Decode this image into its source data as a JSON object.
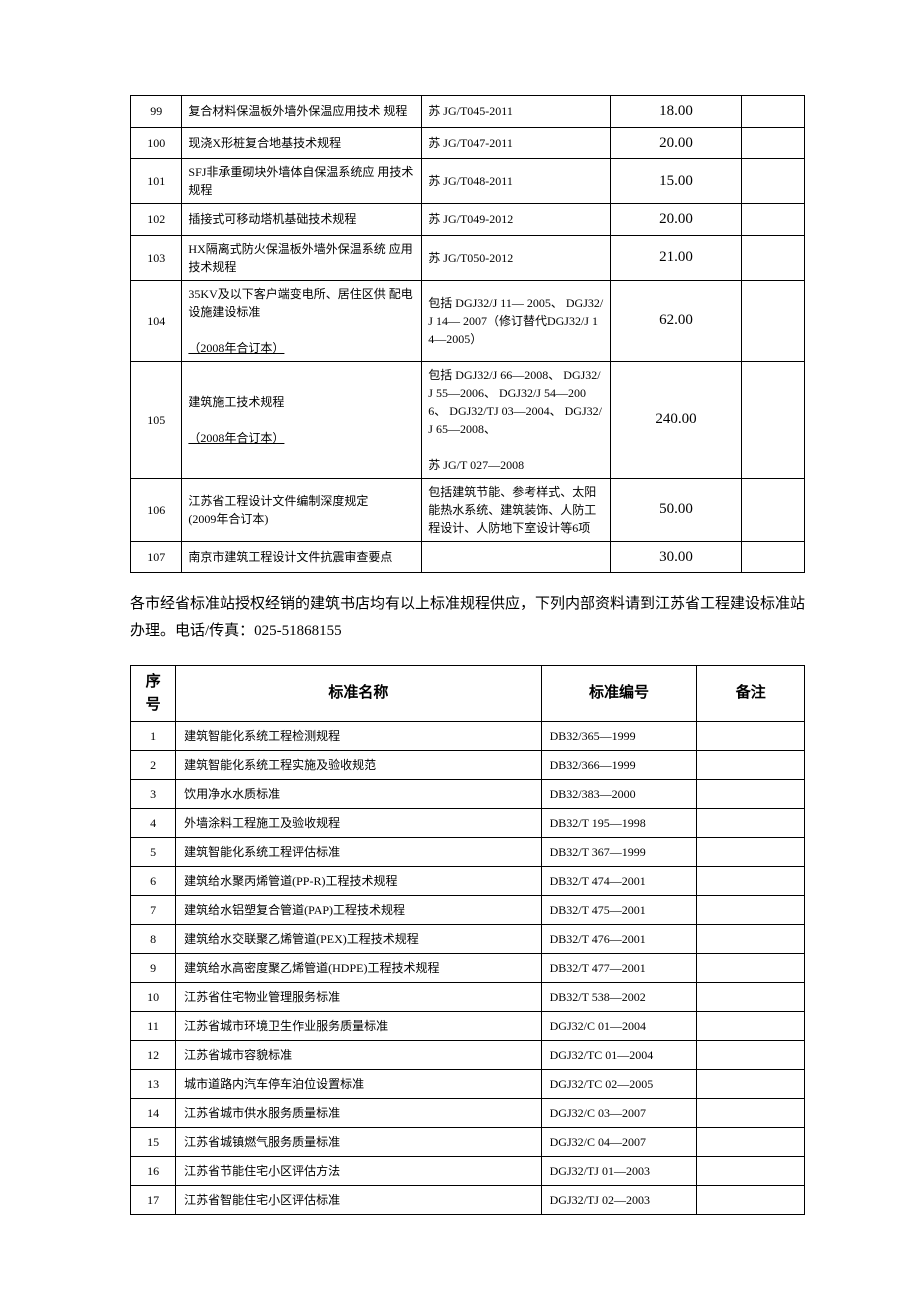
{
  "table1": {
    "rows": [
      {
        "seq": "99",
        "name_html": "复合材料保温板外墙外保温应用技术 规程",
        "code": "苏 JG/T045-2011",
        "price": "18.00",
        "price_small": false,
        "note": ""
      },
      {
        "seq": "100",
        "name_html": "现浇X形桩复合地基技术规程",
        "code": "苏 JG/T047-2011",
        "price": "20.00",
        "price_small": false,
        "note": ""
      },
      {
        "seq": "101",
        "name_html": "SFJ非承重砌块外墙体自保温系统应 用技术规程",
        "code": "苏 JG/T048-2011",
        "price": "15.00",
        "price_small": false,
        "note": ""
      },
      {
        "seq": "102",
        "name_html": "插接式可移动塔机基础技术规程",
        "code": "苏 JG/T049-2012",
        "price": "20.00",
        "price_small": false,
        "note": ""
      },
      {
        "seq": "103",
        "name_html": "HX隔离式防火保温板外墙外保温系统 应用技术规程",
        "code": "苏 JG/T050-2012",
        "price": "21.00",
        "price_small": false,
        "note": ""
      },
      {
        "seq": "104",
        "name_html": "35KV及以下客户端变电所、居住区供 配电设施建设标准<br><br><span class=\"u\">（2008年合订本）</span>",
        "code": "包括 DGJ32/J 11— 2005、 DGJ32/J 14— 2007（修订替代DGJ32/J 14—2005）",
        "price": "62.00",
        "price_small": true,
        "note": ""
      },
      {
        "seq": "105",
        "name_html": "建筑施工技术规程<br><br><span class=\"u\">（2008年合订本）</span>",
        "code": "包括 DGJ32/J 66—2008、 DGJ32/J 55—2006、 DGJ32/J 54—2006、 DGJ32/TJ 03—2004、 DGJ32/J 65—2008、<br><br>苏 JG/T 027—2008",
        "price": "240.00",
        "price_small": true,
        "note": ""
      },
      {
        "seq": "106",
        "name_html": "江苏省工程设计文件编制深度规定<br>(2009年合订本)",
        "code": "包括建筑节能、参考样式、太阳能热水系统、建筑装饰、人防工程设计、人防地下室设计等6项",
        "price": "50.00",
        "price_small": true,
        "note": ""
      },
      {
        "seq": "107",
        "name_html": "南京市建筑工程设计文件抗震审查要点",
        "code": "",
        "price": "30.00",
        "price_small": true,
        "note": ""
      }
    ]
  },
  "body_text": "各市经省标准站授权经销的建筑书店均有以上标准规程供应，下列内部资料请到江苏省工程建设标准站办理。电话/传真：025-51868155",
  "table2": {
    "headers": {
      "seq": "序号",
      "name": "标准名称",
      "code": "标准编号",
      "note": "备注"
    },
    "rows": [
      {
        "seq": "1",
        "name": "建筑智能化系统工程检测规程",
        "code": "DB32/365—1999",
        "note": ""
      },
      {
        "seq": "2",
        "name": "建筑智能化系统工程实施及验收规范",
        "code": "DB32/366—1999",
        "note": ""
      },
      {
        "seq": "3",
        "name": "饮用净水水质标准",
        "code": "DB32/383—2000",
        "note": ""
      },
      {
        "seq": "4",
        "name": "外墙涂料工程施工及验收规程",
        "code": "DB32/T 195—1998",
        "note": ""
      },
      {
        "seq": "5",
        "name": "建筑智能化系统工程评估标准",
        "code": "DB32/T 367—1999",
        "note": ""
      },
      {
        "seq": "6",
        "name": "建筑给水聚丙烯管道(PP-R)工程技术规程",
        "code": "DB32/T 474—2001",
        "note": ""
      },
      {
        "seq": "7",
        "name": "建筑给水铝塑复合管道(PAP)工程技术规程",
        "code": "DB32/T 475—2001",
        "note": ""
      },
      {
        "seq": "8",
        "name": "建筑给水交联聚乙烯管道(PEX)工程技术规程",
        "code": "DB32/T 476—2001",
        "note": ""
      },
      {
        "seq": "9",
        "name": "建筑给水高密度聚乙烯管道(HDPE)工程技术规程",
        "code": "DB32/T 477—2001",
        "note": ""
      },
      {
        "seq": "10",
        "name": "江苏省住宅物业管理服务标准",
        "code": "DB32/T 538—2002",
        "note": ""
      },
      {
        "seq": "11",
        "name": "江苏省城市环境卫生作业服务质量标准",
        "code": "DGJ32/C 01—2004",
        "note": ""
      },
      {
        "seq": "12",
        "name": "江苏省城市容貌标准",
        "code": "DGJ32/TC 01—2004",
        "note": ""
      },
      {
        "seq": "13",
        "name": "城市道路内汽车停车泊位设置标准",
        "code": "DGJ32/TC 02—2005",
        "note": ""
      },
      {
        "seq": "14",
        "name": "江苏省城市供水服务质量标准",
        "code": "DGJ32/C 03—2007",
        "note": ""
      },
      {
        "seq": "15",
        "name": "江苏省城镇燃气服务质量标准",
        "code": "DGJ32/C 04—2007",
        "note": ""
      },
      {
        "seq": "16",
        "name": "江苏省节能住宅小区评估方法",
        "code": "DGJ32/TJ 01—2003",
        "note": ""
      },
      {
        "seq": "17",
        "name": "江苏省智能住宅小区评估标准",
        "code": "DGJ32/TJ 02—2003",
        "note": ""
      }
    ]
  }
}
